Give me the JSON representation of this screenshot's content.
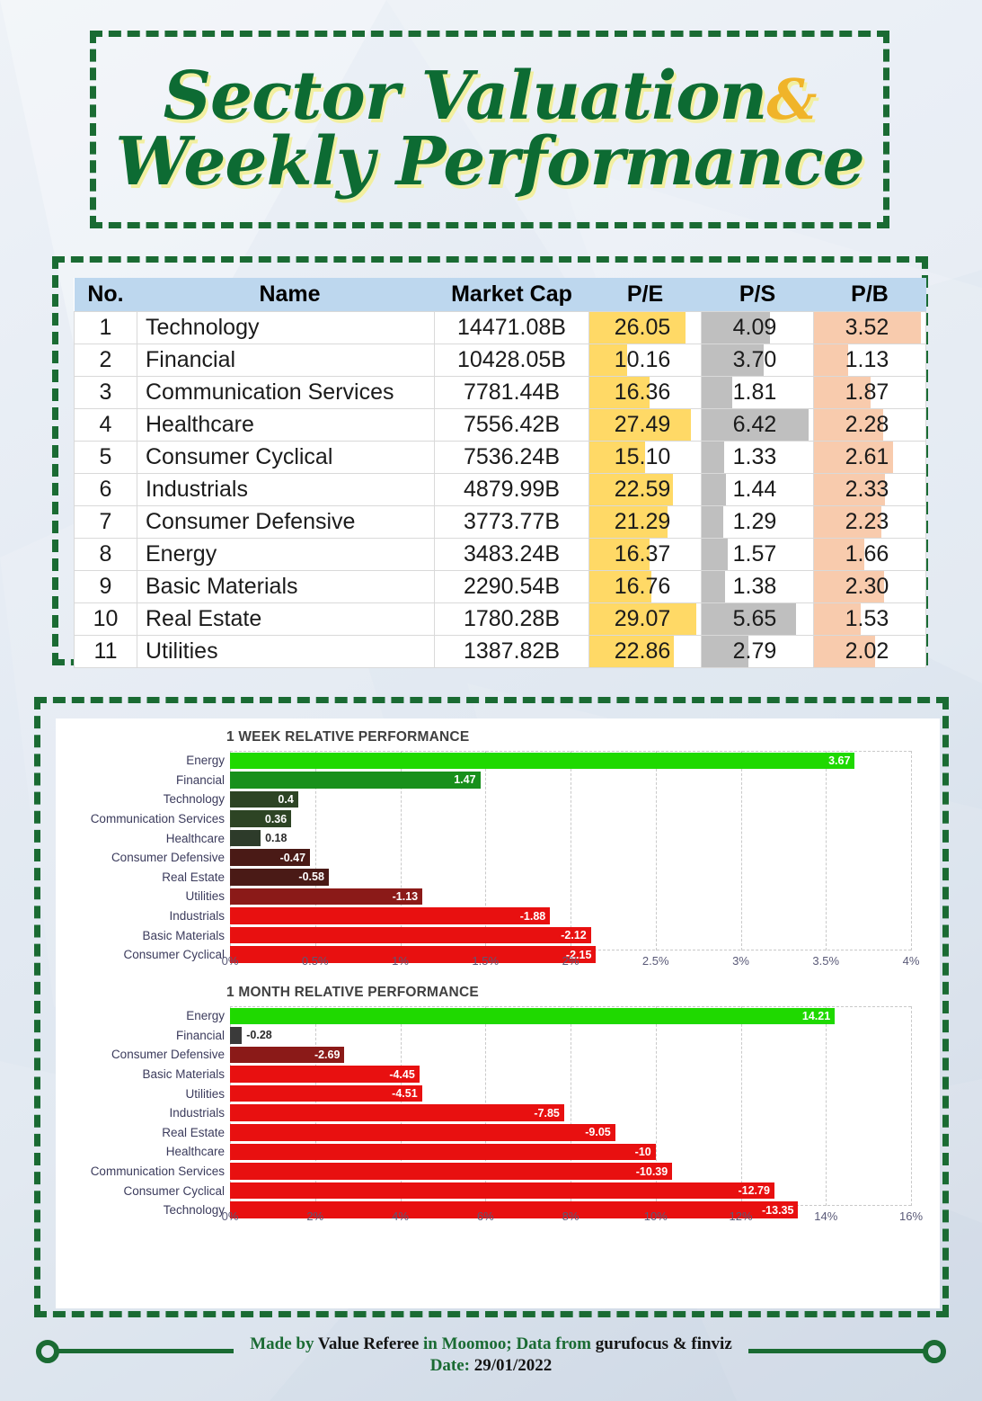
{
  "title": {
    "line1": "Sector Valuation",
    "amp": "&",
    "line2": "Weekly Performance"
  },
  "table": {
    "columns": [
      "No.",
      "Name",
      "Market Cap",
      "P/E",
      "P/S",
      "P/B"
    ],
    "rows": [
      {
        "no": "1",
        "name": "Technology",
        "cap": "14471.08B",
        "pe": "26.05",
        "ps": "4.09",
        "pb": "3.52"
      },
      {
        "no": "2",
        "name": "Financial",
        "cap": "10428.05B",
        "pe": "10.16",
        "ps": "3.70",
        "pb": "1.13"
      },
      {
        "no": "3",
        "name": "Communication Services",
        "cap": "7781.44B",
        "pe": "16.36",
        "ps": "1.81",
        "pb": "1.87"
      },
      {
        "no": "4",
        "name": "Healthcare",
        "cap": "7556.42B",
        "pe": "27.49",
        "ps": "6.42",
        "pb": "2.28"
      },
      {
        "no": "5",
        "name": "Consumer Cyclical",
        "cap": "7536.24B",
        "pe": "15.10",
        "ps": "1.33",
        "pb": "2.61"
      },
      {
        "no": "6",
        "name": "Industrials",
        "cap": "4879.99B",
        "pe": "22.59",
        "ps": "1.44",
        "pb": "2.33"
      },
      {
        "no": "7",
        "name": "Consumer Defensive",
        "cap": "3773.77B",
        "pe": "21.29",
        "ps": "1.29",
        "pb": "2.23"
      },
      {
        "no": "8",
        "name": "Energy",
        "cap": "3483.24B",
        "pe": "16.37",
        "ps": "1.57",
        "pb": "1.66"
      },
      {
        "no": "9",
        "name": "Basic Materials",
        "cap": "2290.54B",
        "pe": "16.76",
        "ps": "1.38",
        "pb": "2.30"
      },
      {
        "no": "10",
        "name": "Real Estate",
        "cap": "1780.28B",
        "pe": "29.07",
        "ps": "5.65",
        "pb": "1.53"
      },
      {
        "no": "11",
        "name": "Utilities",
        "cap": "1387.82B",
        "pe": "22.86",
        "ps": "2.79",
        "pb": "2.02"
      }
    ],
    "bar_colors": {
      "pe": "#ffd966",
      "ps": "#bfbfbf",
      "pb": "#f8cbad"
    },
    "header_bg": "#bdd7ee"
  },
  "chart_data": [
    {
      "type": "bar",
      "orientation": "horizontal",
      "title": "1 WEEK RELATIVE PERFORMANCE",
      "xlabel": "",
      "ylabel": "",
      "xlim": [
        0,
        4
      ],
      "xticks": [
        "0%",
        "0.5%",
        "1%",
        "1.5%",
        "2%",
        "2.5%",
        "3%",
        "3.5%",
        "4%"
      ],
      "xtick_values": [
        0,
        0.5,
        1,
        1.5,
        2,
        2.5,
        3,
        3.5,
        4
      ],
      "grid": true,
      "legend": "none",
      "categories": [
        "Energy",
        "Financial",
        "Technology",
        "Communication Services",
        "Healthcare",
        "Consumer Defensive",
        "Real Estate",
        "Utilities",
        "Industrials",
        "Basic Materials",
        "Consumer Cyclical"
      ],
      "values": [
        3.67,
        1.47,
        0.4,
        0.36,
        0.18,
        -0.47,
        -0.58,
        -1.13,
        -1.88,
        -2.12,
        -2.15
      ],
      "labels": [
        "3.67",
        "1.47",
        "0.4",
        "0.36",
        "0.18",
        "-0.47",
        "-0.58",
        "-1.13",
        "-1.88",
        "-2.12",
        "-2.15"
      ],
      "colors": [
        "#1fd900",
        "#18901c",
        "#2d4424",
        "#2d4424",
        "#2d3b2a",
        "#4a1a16",
        "#4a1a16",
        "#8b1a18",
        "#e81010",
        "#e81010",
        "#e81010"
      ],
      "label_outside": [
        false,
        false,
        false,
        false,
        true,
        false,
        false,
        false,
        false,
        false,
        false
      ]
    },
    {
      "type": "bar",
      "orientation": "horizontal",
      "title": "1 MONTH RELATIVE PERFORMANCE",
      "xlabel": "",
      "ylabel": "",
      "xlim": [
        0,
        16
      ],
      "xticks": [
        "0%",
        "2%",
        "4%",
        "6%",
        "8%",
        "10%",
        "12%",
        "14%",
        "16%"
      ],
      "xtick_values": [
        0,
        2,
        4,
        6,
        8,
        10,
        12,
        14,
        16
      ],
      "grid": true,
      "legend": "none",
      "categories": [
        "Energy",
        "Financial",
        "Consumer Defensive",
        "Basic Materials",
        "Utilities",
        "Industrials",
        "Real Estate",
        "Healthcare",
        "Communication Services",
        "Consumer Cyclical",
        "Technology"
      ],
      "values": [
        14.21,
        -0.28,
        -2.69,
        -4.45,
        -4.51,
        -7.85,
        -9.05,
        -10,
        -10.39,
        -12.79,
        -13.35
      ],
      "labels": [
        "14.21",
        "-0.28",
        "-2.69",
        "-4.45",
        "-4.51",
        "-7.85",
        "-9.05",
        "-10",
        "-10.39",
        "-12.79",
        "-13.35"
      ],
      "colors": [
        "#1fd900",
        "#3a3a3a",
        "#8b1a18",
        "#e81010",
        "#e81010",
        "#e81010",
        "#e81010",
        "#e81010",
        "#e81010",
        "#e81010",
        "#e81010"
      ],
      "label_outside": [
        false,
        true,
        false,
        false,
        false,
        false,
        false,
        false,
        false,
        false,
        false
      ]
    }
  ],
  "footer": {
    "made_by": "Made by ",
    "author": "Value Referee",
    "platform": " in Moomoo; Data from ",
    "sources": "gurufocus & finviz",
    "date_label": "Date: ",
    "date_value": "29/01/2022"
  },
  "colors": {
    "accent_green": "#1a6b33",
    "title_green": "#0d6b33",
    "title_shadow": "#f2efa0",
    "amp_gold": "#f0b429"
  }
}
